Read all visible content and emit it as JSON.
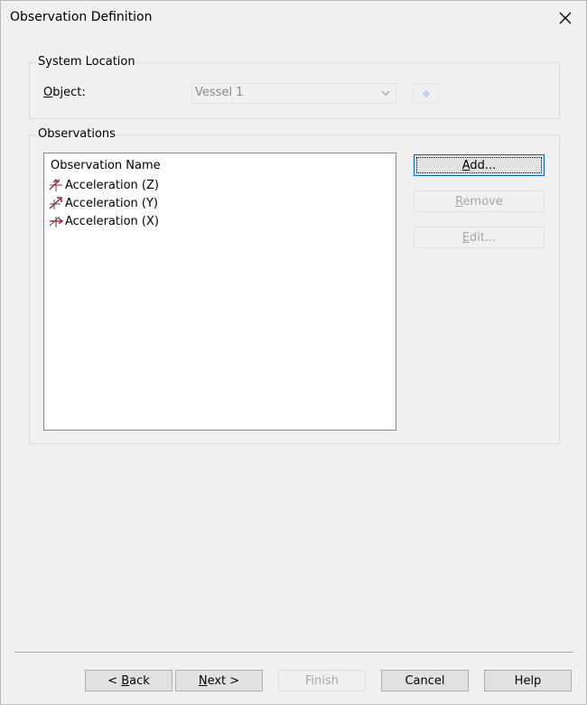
{
  "window": {
    "title": "Observation Definition"
  },
  "system_location": {
    "group_label": "System Location",
    "object_label": "Object:",
    "object_value": "Vessel 1"
  },
  "observations": {
    "group_label": "Observations",
    "list_header": "Observation Name",
    "items": [
      {
        "label": "Acceleration (Z)",
        "icon": "acceleration-z-icon"
      },
      {
        "label": "Acceleration (Y)",
        "icon": "acceleration-y-icon"
      },
      {
        "label": "Acceleration (X)",
        "icon": "acceleration-x-icon"
      }
    ],
    "buttons": {
      "add": "Add...",
      "remove": "Remove",
      "edit": "Edit..."
    }
  },
  "footer": {
    "back": "< Back",
    "next": "Next >",
    "finish": "Finish",
    "cancel": "Cancel",
    "help": "Help"
  },
  "colors": {
    "icon_red": "#a0203a",
    "icon_dark": "#4a4a4a",
    "accent": "#0067c0"
  }
}
